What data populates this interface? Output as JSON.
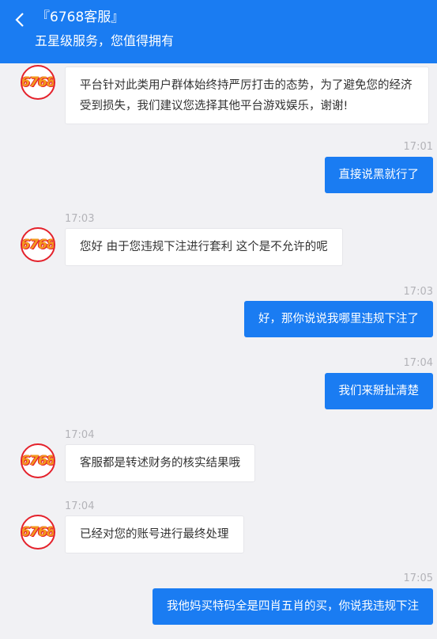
{
  "header": {
    "title": "『6768客服』",
    "subtitle": "五星级服务，您值得拥有"
  },
  "avatar_text": "6768",
  "messages": [
    {
      "side": "in",
      "time": "",
      "text": "平台针对此类用户群体始终持严厉打击的态势，为了避免您的经济受到损失，我们建议您选择其他平台游戏娱乐，谢谢!"
    },
    {
      "side": "out",
      "time": "17:01",
      "text": "直接说黑就行了"
    },
    {
      "side": "in",
      "time": "17:03",
      "text": "您好 由于您违规下注进行套利 这个是不允许的呢"
    },
    {
      "side": "out",
      "time": "17:03",
      "text": "好，那你说说我哪里违规下注了"
    },
    {
      "side": "out",
      "time": "17:04",
      "text": "我们来掰扯清楚"
    },
    {
      "side": "in",
      "time": "17:04",
      "text": "客服都是转述财务的核实结果哦"
    },
    {
      "side": "in",
      "time": "17:04",
      "text": "已经对您的账号进行最终处理"
    },
    {
      "side": "out",
      "time": "17:05",
      "text": "我他妈买特码全是四肖五肖的买，你说我违规下注"
    }
  ],
  "colors": {
    "header_bg": "#1a7cf2",
    "outgoing_bubble": "#1a7cf2",
    "incoming_bubble": "#ffffff",
    "page_bg": "#f1f1f4"
  }
}
